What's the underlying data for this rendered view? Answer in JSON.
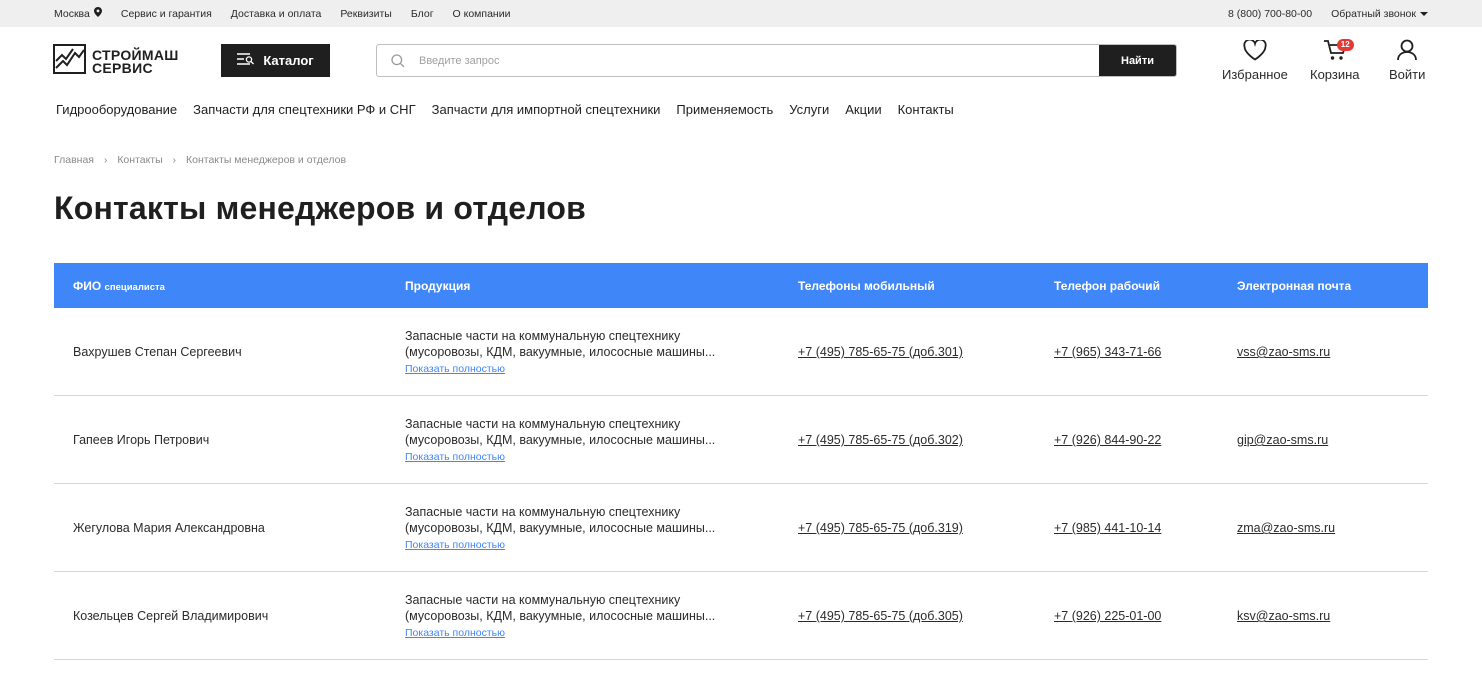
{
  "topbar": {
    "city": "Москва",
    "links": [
      "Сервис и гарантия",
      "Доставка и оплата",
      "Реквизиты",
      "Блог",
      "О компании"
    ],
    "phone": "8 (800) 700-80-00",
    "callback": "Обратный звонок"
  },
  "header": {
    "logo_line1": "СТРОЙМАШ",
    "logo_line2": "СЕРВИС",
    "catalog_label": "Каталог",
    "search_placeholder": "Введите запрос",
    "search_button": "Найти",
    "favorites_label": "Избранное",
    "cart_label": "Корзина",
    "cart_count": "12",
    "login_label": "Войти"
  },
  "nav": [
    "Гидрооборудование",
    "Запчасти для спецтехники РФ и СНГ",
    "Запчасти для импортной спецтехники",
    "Применяемость",
    "Услуги",
    "Акции",
    "Контакты"
  ],
  "breadcrumb": [
    "Главная",
    "Контакты",
    "Контакты менеджеров и отделов"
  ],
  "page_title": "Контакты менеджеров и отделов",
  "table": {
    "headers": {
      "name": "ФИО",
      "name_small": "специалиста",
      "product": "Продукция",
      "mobile": "Телефоны мобильный",
      "work": "Телефон рабочий",
      "email": "Электронная почта"
    },
    "show_more": "Показать полностью",
    "rows": [
      {
        "name": "Вахрушев Степан Сергеевич",
        "product_line1": "Запасные части на коммунальную спецтехнику",
        "product_line2": "(мусоровозы, КДМ, вакуумные, илососные машины...",
        "mobile": "+7 (495) 785-65-75 (доб.301)",
        "work": "+7 (965) 343-71-66",
        "email": "vss@zao-sms.ru"
      },
      {
        "name": "Гапеев Игорь Петрович",
        "product_line1": "Запасные части на коммунальную спецтехнику",
        "product_line2": "(мусоровозы, КДМ, вакуумные, илососные машины...",
        "mobile": "+7 (495) 785-65-75 (доб.302)",
        "work": "+7 (926) 844-90-22",
        "email": "gip@zao-sms.ru"
      },
      {
        "name": "Жегулова Мария Александровна",
        "product_line1": "Запасные части на коммунальную спецтехнику",
        "product_line2": "(мусоровозы, КДМ, вакуумные, илососные машины...",
        "mobile": "+7 (495) 785-65-75 (доб.319)",
        "work": "+7 (985) 441-10-14",
        "email": "zma@zao-sms.ru"
      },
      {
        "name": "Козельцев Сергей Владимирович",
        "product_line1": "Запасные части на коммунальную спецтехнику",
        "product_line2": "(мусоровозы, КДМ, вакуумные, илососные машины...",
        "mobile": "+7 (495) 785-65-75 (доб.305)",
        "work": "+7 (926) 225-01-00",
        "email": "ksv@zao-sms.ru"
      }
    ]
  },
  "colors": {
    "accent": "#3f86f9",
    "dark": "#1f1f1f",
    "badge": "#e53935",
    "topbar_bg": "#efefef"
  },
  "icons": [
    "location-pin-icon",
    "chevron-down-icon",
    "menu-icon",
    "search-icon",
    "heart-icon",
    "cart-icon",
    "user-icon",
    "chevron-right-icon"
  ]
}
